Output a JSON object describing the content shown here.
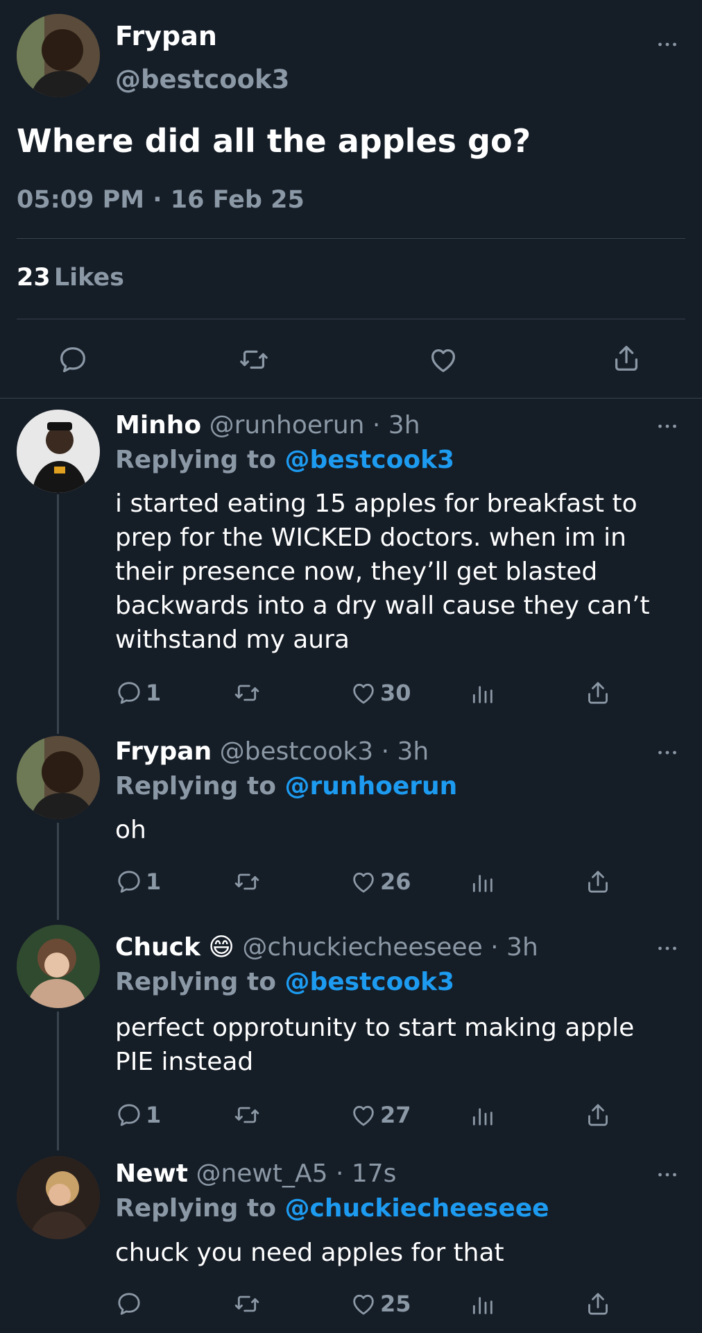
{
  "main_tweet": {
    "author_name": "Frypan",
    "author_handle": "@bestcook3",
    "text": "Where did all the apples go?",
    "timestamp": "05:09 PM · 16 Feb 25",
    "likes_count": "23",
    "likes_label": "Likes",
    "icons": [
      "reply-icon",
      "retweet-icon",
      "like-icon",
      "share-icon"
    ]
  },
  "replies": [
    {
      "name": "Minho",
      "meta": "@runhoerun · 3h",
      "replying_prefix": "Replying to",
      "replying_to": "@bestcook3",
      "text": "i started eating 15 apples for breakfast to prep for the WICKED doctors. when im in their presence now, they’ll get blasted backwards into a dry wall cause they can’t withstand my aura",
      "reply_count": "1",
      "like_count": "30"
    },
    {
      "name": "Frypan",
      "meta": "@bestcook3 · 3h",
      "replying_prefix": "Replying to",
      "replying_to": "@runhoerun",
      "text": "oh",
      "reply_count": "1",
      "like_count": "26"
    },
    {
      "name": "Chuck",
      "emoji": "😄",
      "meta": "@chuckiecheeseee · 3h",
      "replying_prefix": "Replying to",
      "replying_to": "@bestcook3",
      "text": "perfect opprotunity to start making apple PIE instead",
      "reply_count": "1",
      "like_count": "27"
    },
    {
      "name": "Newt",
      "meta": "@newt_A5 · 17s",
      "replying_prefix": "Replying to",
      "replying_to": "@chuckiecheeseee",
      "text": "chuck you need apples for that",
      "reply_count": "",
      "like_count": "25"
    }
  ],
  "colors": {
    "background": "#151d27",
    "text": "#ffffff",
    "muted": "#8b98a5",
    "link": "#1d9bf0",
    "divider": "#38444d"
  }
}
